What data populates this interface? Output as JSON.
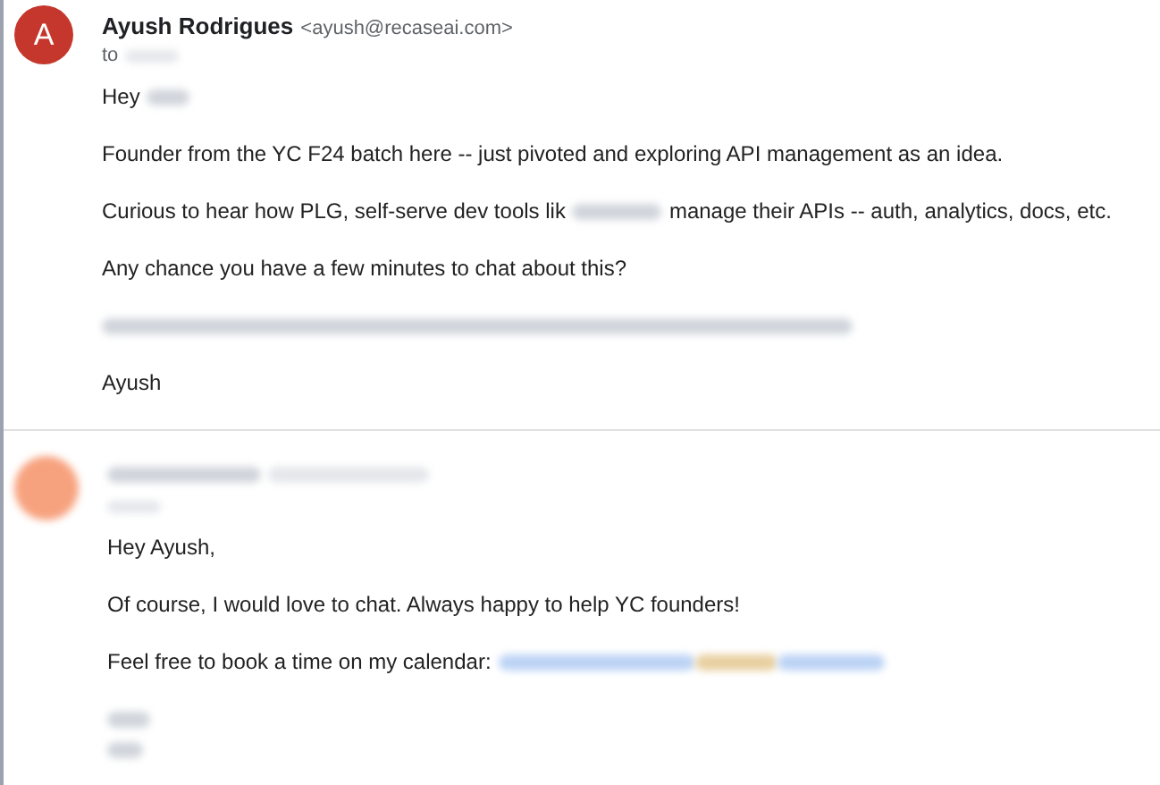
{
  "messages": [
    {
      "avatar": {
        "letter": "A",
        "color": "#c5372c"
      },
      "sender": {
        "name": "Ayush Rodrigues",
        "email": "<ayush@recaseai.com>"
      },
      "to_label": "to",
      "paragraphs": [
        {
          "kind": "text",
          "parts": [
            "Hey"
          ]
        },
        {
          "kind": "text",
          "parts": [
            "Founder from the YC F24 batch here -- just pivoted and exploring API management as an idea."
          ]
        },
        {
          "kind": "text",
          "parts": [
            "Curious to hear how PLG, self-serve dev tools lik",
            "manage their APIs -- auth, analytics, docs, etc."
          ]
        },
        {
          "kind": "text",
          "parts": [
            "Any chance you have a few minutes to chat about this?"
          ]
        },
        {
          "kind": "redacted"
        },
        {
          "kind": "text",
          "parts": [
            "Ayush"
          ]
        }
      ]
    },
    {
      "avatar": {
        "color": "#f7a27e"
      },
      "paragraphs": [
        {
          "kind": "text",
          "parts": [
            "Hey Ayush,"
          ]
        },
        {
          "kind": "text",
          "parts": [
            "Of course, I would love to chat. Always happy to help YC founders!"
          ]
        },
        {
          "kind": "link",
          "parts": [
            "Feel free to book a time on my calendar:"
          ]
        },
        {
          "kind": "signature"
        }
      ]
    }
  ]
}
